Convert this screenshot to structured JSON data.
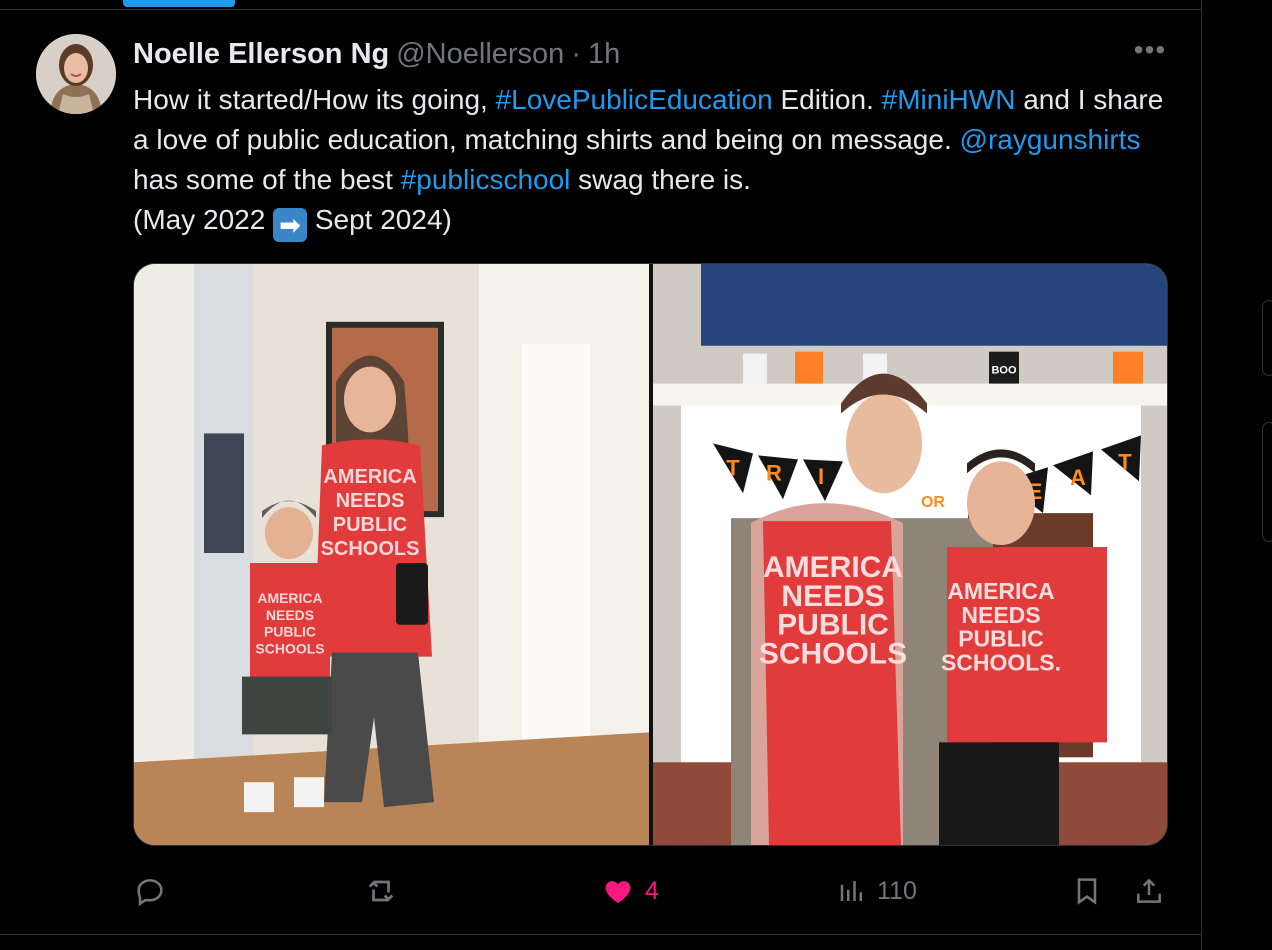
{
  "tweet": {
    "author": {
      "name": "Noelle Ellerson Ng",
      "handle": "@Noellerson",
      "separator": "·",
      "time": "1h"
    },
    "more_label": "•••",
    "text": {
      "part1": "How it started/How its going, ",
      "hashtag1": "#LovePublicEducation",
      "part2": " Edition. ",
      "hashtag2": "#MiniHWN",
      "part3": " and I share a love of public education, matching shirts and being on message. ",
      "mention": "@raygunshirts",
      "part4": " has some of the best ",
      "hashtag3": "#publicschool",
      "part5": " swag there is.",
      "part6_start": "(May 2022 ",
      "emoji": "➡",
      "part6_end": " Sept 2024)"
    },
    "media": {
      "left_shirt_text": [
        "AMERICA",
        "NEEDS",
        "PUBLIC",
        "SCHOOLS"
      ],
      "right_shirt_text": [
        "AMERICA",
        "NEEDS",
        "PUBLIC",
        "SCHOOLS"
      ],
      "banner_text": [
        "T",
        "R",
        "I",
        "OR",
        "E",
        "A",
        "T"
      ],
      "bucket_text": "BOO"
    },
    "actions": {
      "replies": "",
      "reposts": "",
      "likes": "4",
      "views": "110"
    },
    "colors": {
      "link": "#1d9bf0",
      "like": "#f91880",
      "muted": "#71767b",
      "text": "#e7e9ea",
      "shirt": "#e23b3b"
    }
  }
}
